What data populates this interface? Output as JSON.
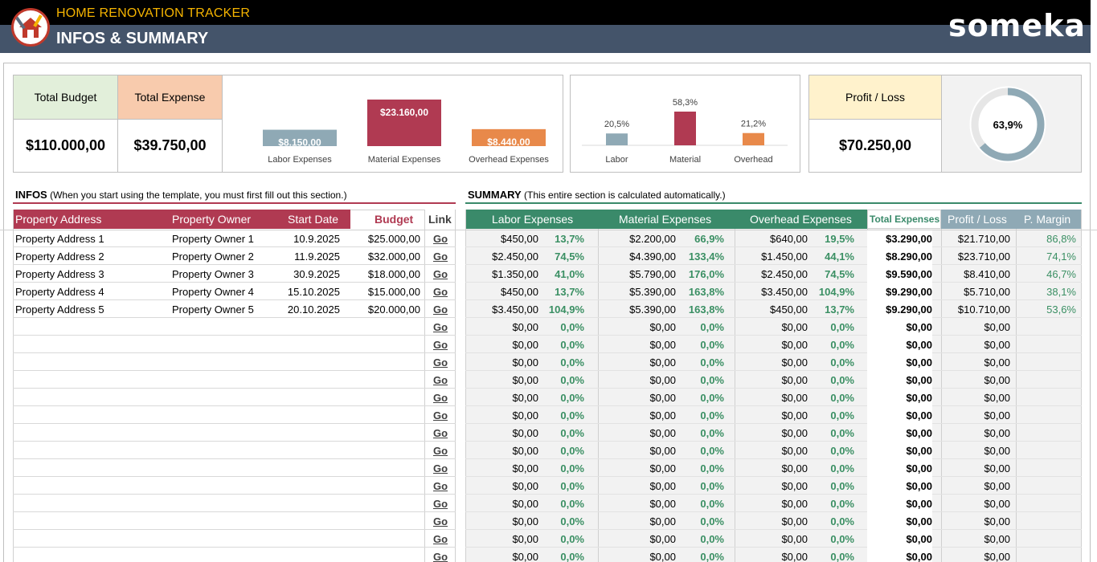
{
  "header": {
    "app_title": "HOME RENOVATION TRACKER",
    "page_title": "INFOS & SUMMARY",
    "brand": "someka"
  },
  "kpis": {
    "total_budget_label": "Total Budget",
    "total_budget_value": "$110.000,00",
    "total_expense_label": "Total Expense",
    "total_expense_value": "$39.750,00",
    "profit_loss_label": "Profit / Loss",
    "profit_loss_value": "$70.250,00",
    "colors": {
      "budget": "#e2efda",
      "expense": "#f8cbad",
      "profit": "#fff2cc"
    }
  },
  "chart_data": [
    {
      "type": "bar",
      "categories": [
        "Labor Expenses",
        "Material Expenses",
        "Overhead Expenses"
      ],
      "values": [
        8150,
        23160,
        8440
      ],
      "labels": [
        "$8.150,00",
        "$23.160,00",
        "$8.440,00"
      ],
      "colors": [
        "#8fa9b5",
        "#b03a52",
        "#e8894a"
      ]
    },
    {
      "type": "bar",
      "categories": [
        "Labor",
        "Material",
        "Overhead"
      ],
      "values": [
        20.5,
        58.3,
        21.2
      ],
      "labels": [
        "20,5%",
        "58,3%",
        "21,2%"
      ],
      "colors": [
        "#8fa9b5",
        "#b03a52",
        "#e8894a"
      ]
    },
    {
      "type": "pie",
      "values": [
        63.9,
        36.1
      ],
      "label": "63,9%",
      "colors": [
        "#8fa9b5",
        "#e6e6e6"
      ]
    }
  ],
  "infos": {
    "title": "INFOS",
    "note": "(When you start using the template, you must first fill out this section.)",
    "headers": {
      "address": "Property Address",
      "owner": "Property Owner",
      "date": "Start Date",
      "budget": "Budget",
      "link": "Link"
    },
    "link_text": "Go",
    "rows": [
      {
        "address": "Property Address 1",
        "owner": "Property Owner 1",
        "date": "10.9.2025",
        "budget": "$25.000,00"
      },
      {
        "address": "Property Address 2",
        "owner": "Property Owner 2",
        "date": "11.9.2025",
        "budget": "$32.000,00"
      },
      {
        "address": "Property Address 3",
        "owner": "Property Owner 3",
        "date": "30.9.2025",
        "budget": "$18.000,00"
      },
      {
        "address": "Property Address 4",
        "owner": "Property Owner 4",
        "date": "15.10.2025",
        "budget": "$15.000,00"
      },
      {
        "address": "Property Address 5",
        "owner": "Property Owner 5",
        "date": "20.10.2025",
        "budget": "$20.000,00"
      },
      {
        "address": "",
        "owner": "",
        "date": "",
        "budget": ""
      },
      {
        "address": "",
        "owner": "",
        "date": "",
        "budget": ""
      },
      {
        "address": "",
        "owner": "",
        "date": "",
        "budget": ""
      },
      {
        "address": "",
        "owner": "",
        "date": "",
        "budget": ""
      },
      {
        "address": "",
        "owner": "",
        "date": "",
        "budget": ""
      },
      {
        "address": "",
        "owner": "",
        "date": "",
        "budget": ""
      },
      {
        "address": "",
        "owner": "",
        "date": "",
        "budget": ""
      },
      {
        "address": "",
        "owner": "",
        "date": "",
        "budget": ""
      },
      {
        "address": "",
        "owner": "",
        "date": "",
        "budget": ""
      },
      {
        "address": "",
        "owner": "",
        "date": "",
        "budget": ""
      },
      {
        "address": "",
        "owner": "",
        "date": "",
        "budget": ""
      },
      {
        "address": "",
        "owner": "",
        "date": "",
        "budget": ""
      },
      {
        "address": "",
        "owner": "",
        "date": "",
        "budget": ""
      },
      {
        "address": "",
        "owner": "",
        "date": "",
        "budget": ""
      }
    ]
  },
  "summary": {
    "title": "SUMMARY",
    "note": "(This entire section is calculated automatically.)",
    "headers": {
      "labor": "Labor Expenses",
      "material": "Material Expenses",
      "overhead": "Overhead Expenses",
      "total": "Total Expenses",
      "profit": "Profit / Loss",
      "margin": "P. Margin"
    },
    "rows": [
      {
        "labor": "$450,00",
        "labor_pct": "13,7%",
        "material": "$2.200,00",
        "material_pct": "66,9%",
        "overhead": "$640,00",
        "overhead_pct": "19,5%",
        "total": "$3.290,00",
        "profit": "$21.710,00",
        "margin": "86,8%"
      },
      {
        "labor": "$2.450,00",
        "labor_pct": "74,5%",
        "material": "$4.390,00",
        "material_pct": "133,4%",
        "overhead": "$1.450,00",
        "overhead_pct": "44,1%",
        "total": "$8.290,00",
        "profit": "$23.710,00",
        "margin": "74,1%"
      },
      {
        "labor": "$1.350,00",
        "labor_pct": "41,0%",
        "material": "$5.790,00",
        "material_pct": "176,0%",
        "overhead": "$2.450,00",
        "overhead_pct": "74,5%",
        "total": "$9.590,00",
        "profit": "$8.410,00",
        "margin": "46,7%"
      },
      {
        "labor": "$450,00",
        "labor_pct": "13,7%",
        "material": "$5.390,00",
        "material_pct": "163,8%",
        "overhead": "$3.450,00",
        "overhead_pct": "104,9%",
        "total": "$9.290,00",
        "profit": "$5.710,00",
        "margin": "38,1%"
      },
      {
        "labor": "$3.450,00",
        "labor_pct": "104,9%",
        "material": "$5.390,00",
        "material_pct": "163,8%",
        "overhead": "$450,00",
        "overhead_pct": "13,7%",
        "total": "$9.290,00",
        "profit": "$10.710,00",
        "margin": "53,6%"
      },
      {
        "labor": "$0,00",
        "labor_pct": "0,0%",
        "material": "$0,00",
        "material_pct": "0,0%",
        "overhead": "$0,00",
        "overhead_pct": "0,0%",
        "total": "$0,00",
        "profit": "$0,00",
        "margin": ""
      },
      {
        "labor": "$0,00",
        "labor_pct": "0,0%",
        "material": "$0,00",
        "material_pct": "0,0%",
        "overhead": "$0,00",
        "overhead_pct": "0,0%",
        "total": "$0,00",
        "profit": "$0,00",
        "margin": ""
      },
      {
        "labor": "$0,00",
        "labor_pct": "0,0%",
        "material": "$0,00",
        "material_pct": "0,0%",
        "overhead": "$0,00",
        "overhead_pct": "0,0%",
        "total": "$0,00",
        "profit": "$0,00",
        "margin": ""
      },
      {
        "labor": "$0,00",
        "labor_pct": "0,0%",
        "material": "$0,00",
        "material_pct": "0,0%",
        "overhead": "$0,00",
        "overhead_pct": "0,0%",
        "total": "$0,00",
        "profit": "$0,00",
        "margin": ""
      },
      {
        "labor": "$0,00",
        "labor_pct": "0,0%",
        "material": "$0,00",
        "material_pct": "0,0%",
        "overhead": "$0,00",
        "overhead_pct": "0,0%",
        "total": "$0,00",
        "profit": "$0,00",
        "margin": ""
      },
      {
        "labor": "$0,00",
        "labor_pct": "0,0%",
        "material": "$0,00",
        "material_pct": "0,0%",
        "overhead": "$0,00",
        "overhead_pct": "0,0%",
        "total": "$0,00",
        "profit": "$0,00",
        "margin": ""
      },
      {
        "labor": "$0,00",
        "labor_pct": "0,0%",
        "material": "$0,00",
        "material_pct": "0,0%",
        "overhead": "$0,00",
        "overhead_pct": "0,0%",
        "total": "$0,00",
        "profit": "$0,00",
        "margin": ""
      },
      {
        "labor": "$0,00",
        "labor_pct": "0,0%",
        "material": "$0,00",
        "material_pct": "0,0%",
        "overhead": "$0,00",
        "overhead_pct": "0,0%",
        "total": "$0,00",
        "profit": "$0,00",
        "margin": ""
      },
      {
        "labor": "$0,00",
        "labor_pct": "0,0%",
        "material": "$0,00",
        "material_pct": "0,0%",
        "overhead": "$0,00",
        "overhead_pct": "0,0%",
        "total": "$0,00",
        "profit": "$0,00",
        "margin": ""
      },
      {
        "labor": "$0,00",
        "labor_pct": "0,0%",
        "material": "$0,00",
        "material_pct": "0,0%",
        "overhead": "$0,00",
        "overhead_pct": "0,0%",
        "total": "$0,00",
        "profit": "$0,00",
        "margin": ""
      },
      {
        "labor": "$0,00",
        "labor_pct": "0,0%",
        "material": "$0,00",
        "material_pct": "0,0%",
        "overhead": "$0,00",
        "overhead_pct": "0,0%",
        "total": "$0,00",
        "profit": "$0,00",
        "margin": ""
      },
      {
        "labor": "$0,00",
        "labor_pct": "0,0%",
        "material": "$0,00",
        "material_pct": "0,0%",
        "overhead": "$0,00",
        "overhead_pct": "0,0%",
        "total": "$0,00",
        "profit": "$0,00",
        "margin": ""
      },
      {
        "labor": "$0,00",
        "labor_pct": "0,0%",
        "material": "$0,00",
        "material_pct": "0,0%",
        "overhead": "$0,00",
        "overhead_pct": "0,0%",
        "total": "$0,00",
        "profit": "$0,00",
        "margin": ""
      },
      {
        "labor": "$0,00",
        "labor_pct": "0,0%",
        "material": "$0,00",
        "material_pct": "0,0%",
        "overhead": "$0,00",
        "overhead_pct": "0,0%",
        "total": "$0,00",
        "profit": "$0,00",
        "margin": ""
      }
    ]
  },
  "colors": {
    "infos_header": "#b03a52",
    "summary_header": "#3a8a6a",
    "summary_header_light": "#8fa9b5",
    "summary_bg": "#f2f2f2",
    "accent_green": "#3a8f63"
  }
}
